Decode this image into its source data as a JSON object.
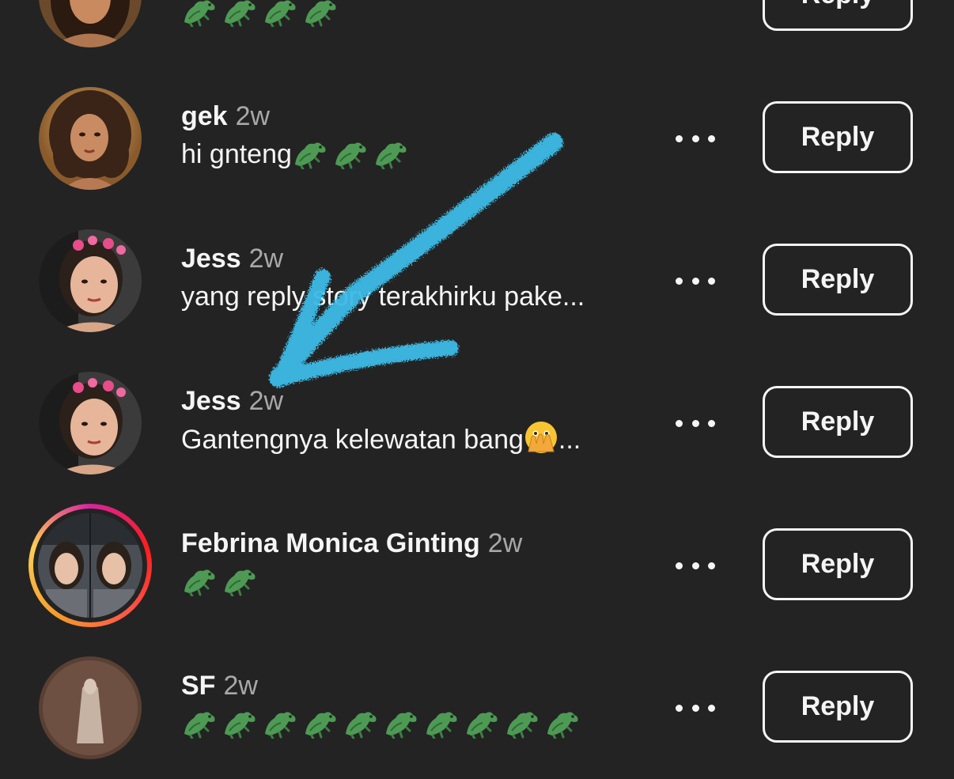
{
  "comments": [
    {
      "name": "",
      "time": "",
      "text": "",
      "crocs": 4,
      "reply_label": "Reply",
      "avatar": "avatar-illustrated-woman"
    },
    {
      "name": "gek",
      "time": "2w",
      "text": "hi gnteng",
      "crocs": 3,
      "reply_label": "Reply",
      "avatar": "avatar-illustrated-woman"
    },
    {
      "name": "Jess",
      "time": "2w",
      "text": "yang reply story terakhirku pake...",
      "crocs": 0,
      "reply_label": "Reply",
      "avatar": "avatar-selfie"
    },
    {
      "name": "Jess",
      "time": "2w",
      "text": "Gantengnya kelewatan bang",
      "suffix": "...",
      "crocs": 0,
      "reply_label": "Reply",
      "avatar": "avatar-selfie"
    },
    {
      "name": "Febrina Monica Ginting",
      "time": "2w",
      "text": "",
      "crocs": 2,
      "reply_label": "Reply",
      "avatar": "avatar-story-ring"
    },
    {
      "name": "SF",
      "time": "2w",
      "text": "",
      "crocs": 10,
      "reply_label": "Reply",
      "avatar": "avatar-dark"
    }
  ],
  "icons": {
    "more": "more-options-icon",
    "crocodile": "crocodile-emoji",
    "peek": "face-with-open-eyes-and-hand-over-mouth-emoji"
  },
  "colors": {
    "background": "#232323",
    "text": "#f5f5f5",
    "muted": "#a8a8a8",
    "arrow": "#3cbbe6"
  }
}
